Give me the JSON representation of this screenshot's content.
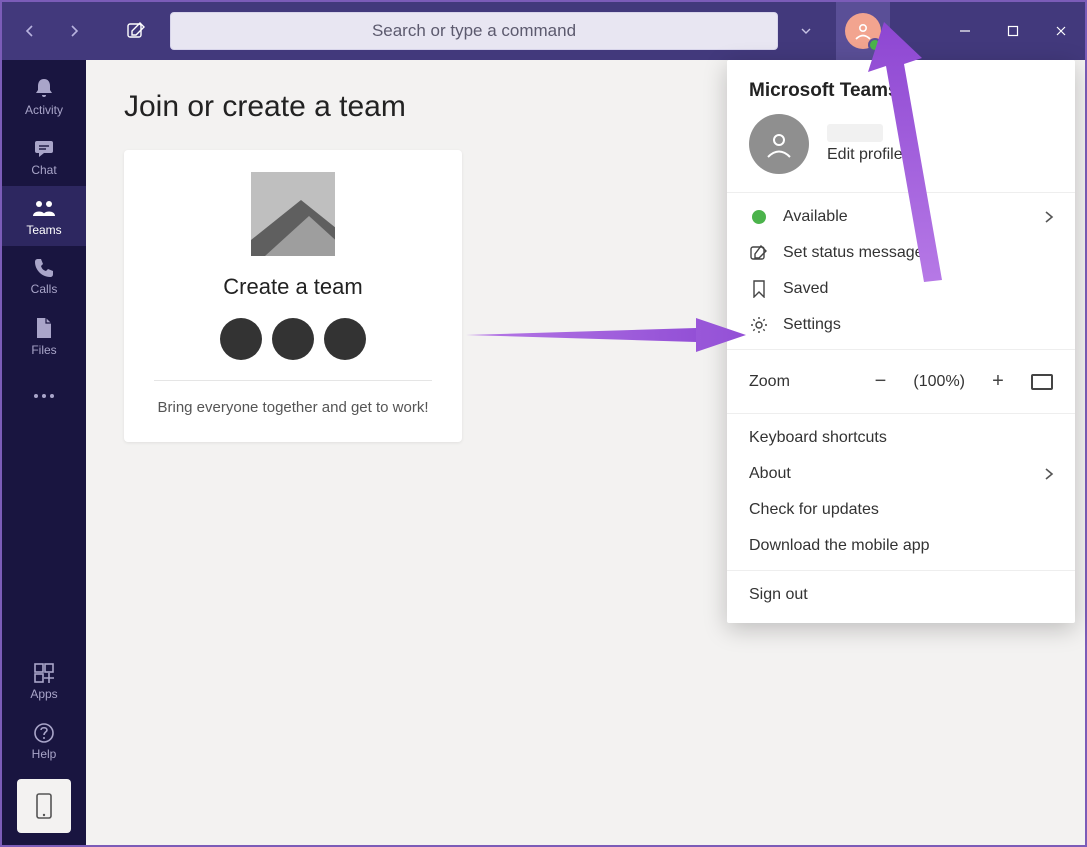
{
  "search": {
    "placeholder": "Search or type a command"
  },
  "rail": {
    "items": [
      {
        "label": "Activity"
      },
      {
        "label": "Chat"
      },
      {
        "label": "Teams"
      },
      {
        "label": "Calls"
      },
      {
        "label": "Files"
      }
    ],
    "apps": "Apps",
    "help": "Help"
  },
  "main": {
    "title": "Join or create a team",
    "card": {
      "title": "Create a team",
      "caption": "Bring everyone together and get to work!"
    }
  },
  "panel": {
    "title": "Microsoft Teams",
    "edit_profile": "Edit profile",
    "status": "Available",
    "set_status": "Set status message",
    "saved": "Saved",
    "settings": "Settings",
    "zoom_label": "Zoom",
    "zoom_value": "(100%)",
    "keyboard": "Keyboard shortcuts",
    "about": "About",
    "updates": "Check for updates",
    "download": "Download the mobile app",
    "signout": "Sign out"
  }
}
